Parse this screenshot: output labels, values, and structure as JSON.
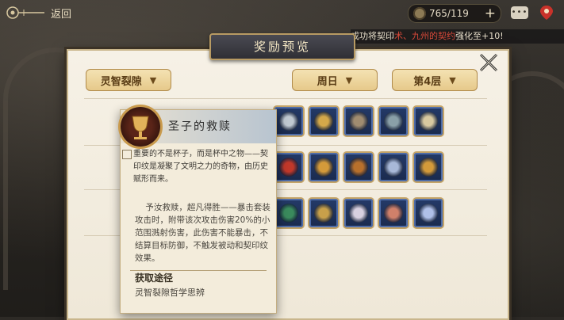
{
  "topbar": {
    "back_label": "返回",
    "resource": "765/119",
    "plus": "+",
    "chat": "•••"
  },
  "marquee": {
    "pre": "成功将契印",
    "highlight": "术、九州的契约",
    "post": "强化至+10!"
  },
  "panel": {
    "title": "奖励预览",
    "dropdowns": {
      "category": "灵智裂隙",
      "day": "周日",
      "floor": "第4层"
    },
    "chevron": "▼"
  },
  "rewards": {
    "rows": [
      [
        "#c0c8d0",
        "#d4a84a",
        "#a08c70",
        "#8aa0a8",
        "#d8c9a0"
      ],
      [
        "#c0382a",
        "#d49a3a",
        "#b8702c",
        "#a8b8d8",
        "#d49a3a"
      ],
      [
        "#3a8a5c",
        "#c8a04a",
        "#d8d0e0",
        "#d0806a",
        "#b0c0e8"
      ]
    ]
  },
  "tooltip": {
    "title": "圣子的救赎",
    "flavor": "重要的不是杯子，而是杯中之物——契印纹是凝聚了文明之力的奇物，由历史赋形而来。",
    "description": "予汝救赎，超凡得胜——暴击套装\n攻击时，附带该次攻击伤害20%的小范围溅射伤害，此伤害不能暴击，不结算目标防御，不触发被动和契印纹效果。",
    "acquire_title": "获取途径",
    "acquire_source": "灵智裂隙哲学思辨"
  },
  "colors": {
    "panel_bg": "#f6f1e6",
    "dropdown_bg": "#e6c98a",
    "slot_bg": "#1a2a4e",
    "slot_border": "#c4a468",
    "marquee_highlight": "#d94a3a"
  }
}
